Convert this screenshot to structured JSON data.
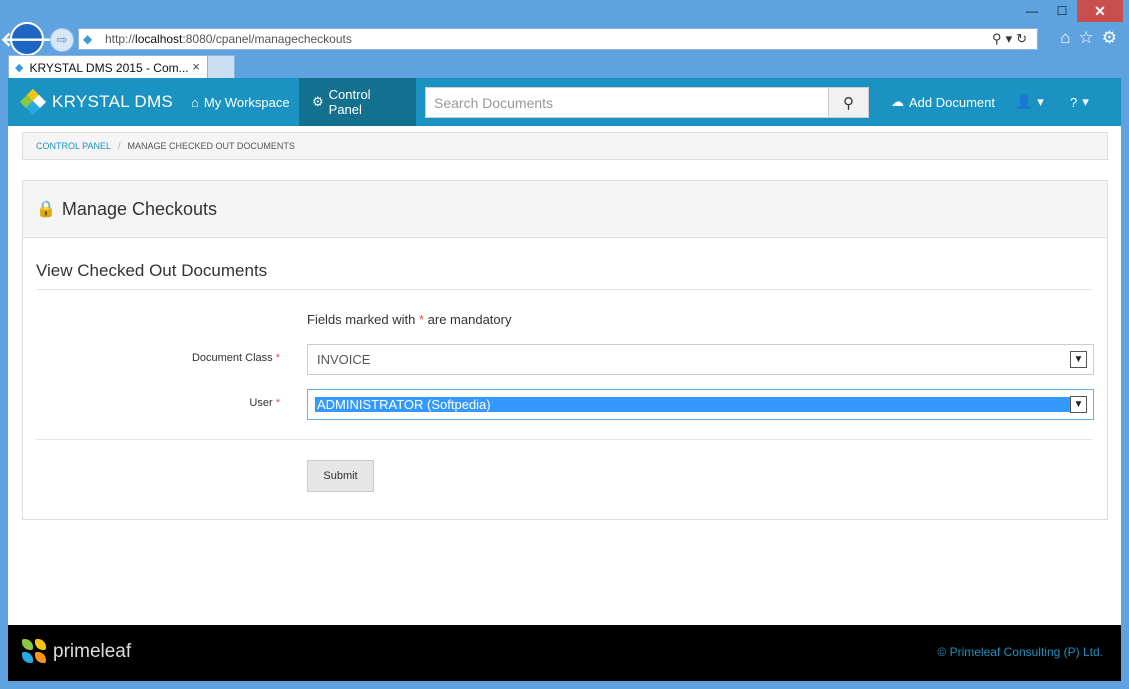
{
  "browser": {
    "url_prefix": "http://",
    "url_host": "localhost",
    "url_rest": ":8080/cpanel/managecheckouts",
    "tab_title": "KRYSTAL DMS 2015 - Com...",
    "tab_close": "×",
    "back_glyph": "🡐",
    "forward_glyph": "⇨",
    "minimize": "—",
    "maximize": "☐",
    "close": "✕"
  },
  "navbar": {
    "brand": "KRYSTAL DMS",
    "my_workspace": "My Workspace",
    "control_panel": "Control Panel",
    "search_placeholder": "Search Documents",
    "add_document": "Add Document",
    "user_caret": "▾",
    "help_caret": "▾"
  },
  "breadcrumb": {
    "link": "CONTROL PANEL",
    "separator": "/",
    "current": "MANAGE CHECKED OUT DOCUMENTS"
  },
  "panel": {
    "heading": "Manage Checkouts",
    "section_title": "View Checked Out Documents",
    "mandatory_before": "Fields marked with ",
    "mandatory_star": "*",
    "mandatory_after": " are mandatory",
    "document_class_label": "Document Class",
    "document_class_value": "INVOICE",
    "user_label": "User",
    "user_value": "ADMINISTRATOR (Softpedia)",
    "required_star": "*",
    "submit": "Submit"
  },
  "footer": {
    "brand": "primeleaf",
    "copyright": "© Primeleaf Consulting (P) Ltd."
  },
  "colors": {
    "accent": "#1a93c2",
    "nav_active": "#13708f",
    "required": "#d9534f",
    "selection": "#3399ff"
  }
}
